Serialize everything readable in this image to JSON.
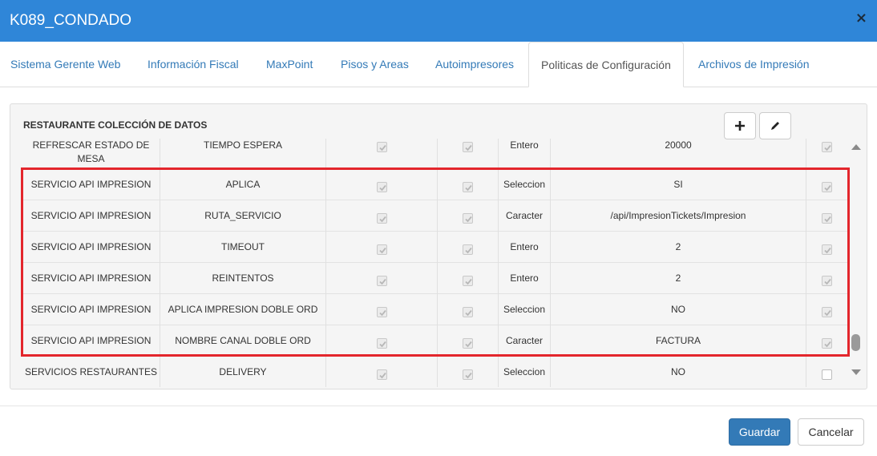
{
  "window": {
    "title": "K089_CONDADO",
    "close_label": "×"
  },
  "tabs": [
    {
      "label": "Sistema Gerente Web"
    },
    {
      "label": "Información Fiscal"
    },
    {
      "label": "MaxPoint"
    },
    {
      "label": "Pisos y Areas"
    },
    {
      "label": "Autoimpresores"
    },
    {
      "label": "Politicas de Configuración",
      "active": true
    },
    {
      "label": "Archivos de Impresión"
    }
  ],
  "panel": {
    "title": "RESTAURANTE COLECCIÓN DE DATOS",
    "add_icon": "plus-icon",
    "edit_icon": "pencil-icon"
  },
  "table": {
    "rows": [
      {
        "coleccion": "REFRESCAR ESTADO DE MESA",
        "parametro": "TIEMPO ESPERA",
        "tipo": "Entero",
        "valor": "20000",
        "check1": true,
        "check2": true,
        "check3": true
      },
      {
        "coleccion": "SERVICIO API IMPRESION",
        "parametro": "APLICA",
        "tipo": "Seleccion",
        "valor": "SI",
        "check1": true,
        "check2": true,
        "check3": true
      },
      {
        "coleccion": "SERVICIO API IMPRESION",
        "parametro": "RUTA_SERVICIO",
        "tipo": "Caracter",
        "valor": "/api/ImpresionTickets/Impresion",
        "check1": true,
        "check2": true,
        "check3": true
      },
      {
        "coleccion": "SERVICIO API IMPRESION",
        "parametro": "TIMEOUT",
        "tipo": "Entero",
        "valor": "2",
        "check1": true,
        "check2": true,
        "check3": true
      },
      {
        "coleccion": "SERVICIO API IMPRESION",
        "parametro": "REINTENTOS",
        "tipo": "Entero",
        "valor": "2",
        "check1": true,
        "check2": true,
        "check3": true
      },
      {
        "coleccion": "SERVICIO API IMPRESION",
        "parametro": "APLICA IMPRESION DOBLE ORD",
        "tipo": "Seleccion",
        "valor": "NO",
        "check1": true,
        "check2": true,
        "check3": true
      },
      {
        "coleccion": "SERVICIO API IMPRESION",
        "parametro": "NOMBRE CANAL DOBLE ORD",
        "tipo": "Caracter",
        "valor": "FACTURA",
        "check1": true,
        "check2": true,
        "check3": true
      },
      {
        "coleccion": "SERVICIOS RESTAURANTES",
        "parametro": "DELIVERY",
        "tipo": "Seleccion",
        "valor": "NO",
        "check1": true,
        "check2": true,
        "check3": false
      }
    ]
  },
  "footer": {
    "save_label": "Guardar",
    "cancel_label": "Cancelar"
  },
  "colors": {
    "header": "#2f86d8",
    "link": "#337ab7",
    "highlight": "#e3262c",
    "primary_button": "#337ab7"
  }
}
